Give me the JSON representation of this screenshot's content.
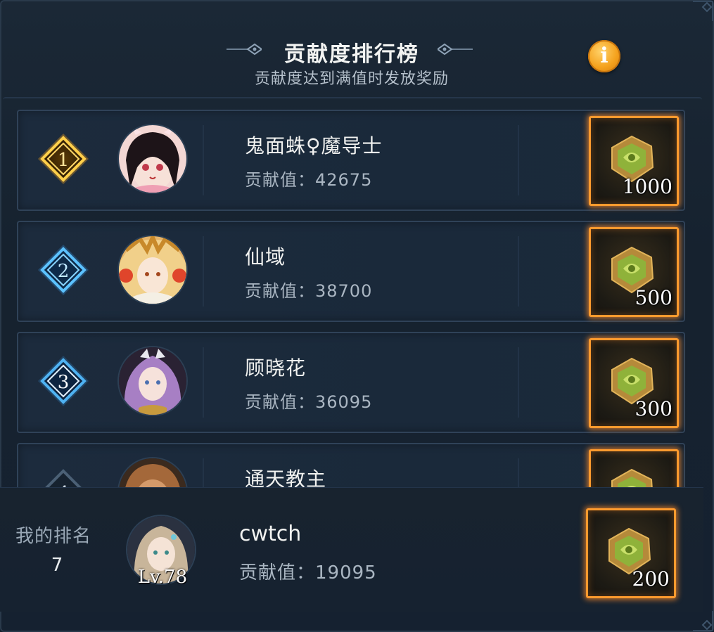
{
  "header": {
    "title": "贡献度排行榜",
    "subtitle": "贡献度达到满值时发放奖励",
    "info_glyph": "i"
  },
  "colors": {
    "gold": "#f5a21e",
    "silver_blue": "#3aa8ff",
    "reward_border": "#ff9a2e"
  },
  "rows": [
    {
      "rank": "1",
      "badge": "gold-diamond-icon",
      "name": "鬼面蛛♀魔导士",
      "score": "贡献值：42675",
      "reward_qty": "1000",
      "avatar": "avatar-girl-black-hair"
    },
    {
      "rank": "2",
      "badge": "blue-diamond-icon",
      "name": "仙域",
      "score": "贡献值：38700",
      "reward_qty": "500",
      "avatar": "avatar-golden-crown"
    },
    {
      "rank": "3",
      "badge": "blue-diamond-icon",
      "name": "顾晓花",
      "score": "贡献值：36095",
      "reward_qty": "300",
      "avatar": "avatar-purple-hair"
    },
    {
      "rank": "4",
      "badge": "gray-diamond-icon",
      "name": "通天教主",
      "score": "",
      "reward_qty": "",
      "avatar": "avatar-lion"
    }
  ],
  "me": {
    "label": "我的排名",
    "rank": "7",
    "name": "cwtch",
    "score": "贡献值：19095",
    "level": "Lv.78",
    "reward_qty": "200"
  }
}
